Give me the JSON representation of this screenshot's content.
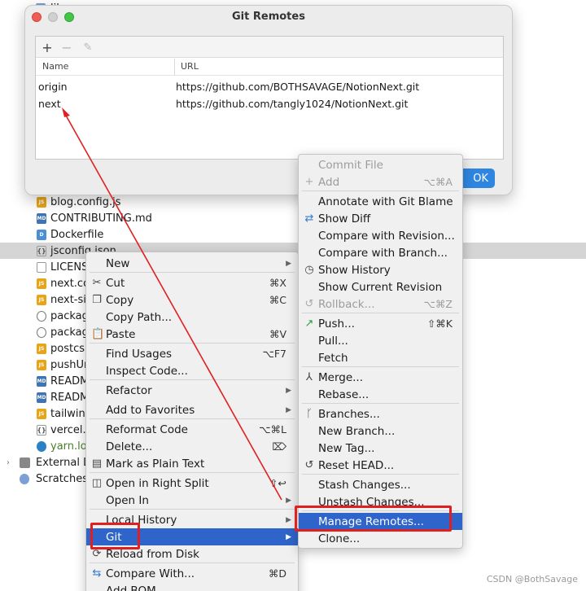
{
  "project_tree": {
    "top_label": "lib",
    "files": [
      {
        "name": "blog.config.js",
        "icon": "js-file-icon",
        "badge": "JS"
      },
      {
        "name": "CONTRIBUTING.md",
        "icon": "md-file-icon",
        "badge": "MD"
      },
      {
        "name": "Dockerfile",
        "icon": "docker-file-icon",
        "badge": "D"
      },
      {
        "name": "jsconfig.json",
        "icon": "json-file-icon",
        "badge": "{}"
      },
      {
        "name": "LICENS",
        "icon": "license-file-icon",
        "badge": ""
      },
      {
        "name": "next.co",
        "icon": "js-file-icon",
        "badge": "JS"
      },
      {
        "name": "next-si",
        "icon": "js-file-icon",
        "badge": "JS"
      },
      {
        "name": "packag",
        "icon": "gear-file-icon",
        "badge": ""
      },
      {
        "name": "packag",
        "icon": "gear-file-icon",
        "badge": ""
      },
      {
        "name": "postcs",
        "icon": "js-file-icon",
        "badge": "JS"
      },
      {
        "name": "pushUr",
        "icon": "js-file-icon",
        "badge": "JS"
      },
      {
        "name": "READM",
        "icon": "md-file-icon",
        "badge": "MD"
      },
      {
        "name": "READM",
        "icon": "md-file-icon",
        "badge": "MD"
      },
      {
        "name": "tailwinc",
        "icon": "js-file-icon",
        "badge": "JS"
      },
      {
        "name": "vercel.j",
        "icon": "json-file-icon",
        "badge": "{}"
      },
      {
        "name": "yarn.lo",
        "icon": "yarn-file-icon",
        "badge": ""
      }
    ],
    "external": "External L",
    "scratches": "Scratches"
  },
  "dialog": {
    "title": "Git Remotes",
    "toolbar": {
      "add": "+",
      "remove": "−",
      "edit": "✎"
    },
    "columns": {
      "name": "Name",
      "url": "URL"
    },
    "remotes": [
      {
        "name": "origin",
        "url": "https://github.com/BOTHSAVAGE/NotionNext.git"
      },
      {
        "name": "next",
        "url": "https://github.com/tangly1024/NotionNext.git"
      }
    ],
    "ok": "OK"
  },
  "context_menu": {
    "items": [
      {
        "label": "New",
        "icon": "",
        "shortcut": "",
        "submenu": true
      },
      {
        "label": "Cut",
        "icon": "✂",
        "shortcut": "⌘X",
        "submenu": false
      },
      {
        "label": "Copy",
        "icon": "❐",
        "shortcut": "⌘C",
        "submenu": false
      },
      {
        "label": "Copy Path...",
        "icon": "",
        "shortcut": "",
        "submenu": false
      },
      {
        "label": "Paste",
        "icon": "📋",
        "shortcut": "⌘V",
        "submenu": false
      },
      {
        "label": "Find Usages",
        "icon": "",
        "shortcut": "⌥F7",
        "submenu": false
      },
      {
        "label": "Inspect Code...",
        "icon": "",
        "shortcut": "",
        "submenu": false
      },
      {
        "label": "Refactor",
        "icon": "",
        "shortcut": "",
        "submenu": true
      },
      {
        "label": "Add to Favorites",
        "icon": "",
        "shortcut": "",
        "submenu": true
      },
      {
        "label": "Reformat Code",
        "icon": "",
        "shortcut": "⌥⌘L",
        "submenu": false
      },
      {
        "label": "Delete...",
        "icon": "",
        "shortcut": "⌦",
        "submenu": false
      },
      {
        "label": "Mark as Plain Text",
        "icon": "▤",
        "shortcut": "",
        "submenu": false
      },
      {
        "label": "Open in Right Split",
        "icon": "◫",
        "shortcut": "⇧↩",
        "submenu": false
      },
      {
        "label": "Open In",
        "icon": "",
        "shortcut": "",
        "submenu": true
      },
      {
        "label": "Local History",
        "icon": "",
        "shortcut": "",
        "submenu": true
      },
      {
        "label": "Git",
        "icon": "",
        "shortcut": "",
        "submenu": true
      },
      {
        "label": "Reload from Disk",
        "icon": "⟳",
        "shortcut": "",
        "submenu": false
      },
      {
        "label": "Compare With...",
        "icon": "⇆",
        "shortcut": "⌘D",
        "submenu": false
      },
      {
        "label": "Add BOM",
        "icon": "",
        "shortcut": "",
        "submenu": false
      }
    ]
  },
  "git_submenu": {
    "items": [
      {
        "label": "Commit File",
        "icon": "",
        "shortcut": "",
        "disabled": true
      },
      {
        "label": "Add",
        "icon": "+",
        "shortcut": "⌥⌘A",
        "disabled": true
      },
      {
        "label": "Annotate with Git Blame",
        "icon": "",
        "shortcut": "",
        "disabled": false
      },
      {
        "label": "Show Diff",
        "icon": "⇄",
        "shortcut": "",
        "disabled": false
      },
      {
        "label": "Compare with Revision...",
        "icon": "",
        "shortcut": "",
        "disabled": false
      },
      {
        "label": "Compare with Branch...",
        "icon": "",
        "shortcut": "",
        "disabled": false
      },
      {
        "label": "Show History",
        "icon": "◷",
        "shortcut": "",
        "disabled": false
      },
      {
        "label": "Show Current Revision",
        "icon": "",
        "shortcut": "",
        "disabled": false
      },
      {
        "label": "Rollback...",
        "icon": "↺",
        "shortcut": "⌥⌘Z",
        "disabled": true
      },
      {
        "label": "Push...",
        "icon": "↗",
        "shortcut": "⇧⌘K",
        "disabled": false
      },
      {
        "label": "Pull...",
        "icon": "",
        "shortcut": "",
        "disabled": false
      },
      {
        "label": "Fetch",
        "icon": "",
        "shortcut": "",
        "disabled": false
      },
      {
        "label": "Merge...",
        "icon": "⅄",
        "shortcut": "",
        "disabled": false
      },
      {
        "label": "Rebase...",
        "icon": "",
        "shortcut": "",
        "disabled": false
      },
      {
        "label": "Branches...",
        "icon": "ᚴ",
        "shortcut": "",
        "disabled": false
      },
      {
        "label": "New Branch...",
        "icon": "",
        "shortcut": "",
        "disabled": false
      },
      {
        "label": "New Tag...",
        "icon": "",
        "shortcut": "",
        "disabled": false
      },
      {
        "label": "Reset HEAD...",
        "icon": "↺",
        "shortcut": "",
        "disabled": false
      },
      {
        "label": "Stash Changes...",
        "icon": "",
        "shortcut": "",
        "disabled": false
      },
      {
        "label": "Unstash Changes...",
        "icon": "",
        "shortcut": "",
        "disabled": false
      },
      {
        "label": "Manage Remotes...",
        "icon": "",
        "shortcut": "",
        "disabled": false
      },
      {
        "label": "Clone...",
        "icon": "",
        "shortcut": "",
        "disabled": false
      }
    ]
  },
  "annotation_color": "#e02020",
  "highlight_color": "#2f65ca",
  "watermark": "CSDN @BothSavage"
}
